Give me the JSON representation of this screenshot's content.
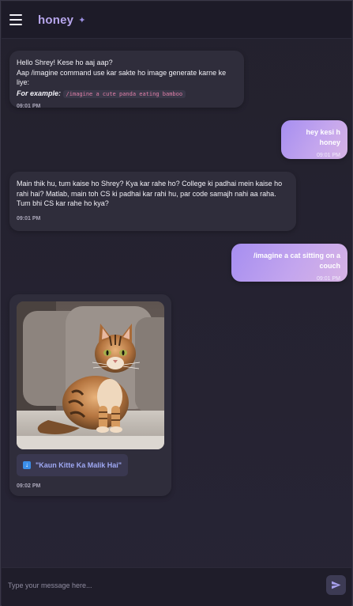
{
  "header": {
    "title": "honey",
    "sparkle": "✦",
    "menu_icon": "hamburger-menu-icon"
  },
  "messages": [
    {
      "role": "bot",
      "line1": "Hello Shrey! Kese ho aaj aap?",
      "line2": "Aap /imagine command use kar sakte ho image generate karne ke liye:",
      "example_label": "For example:",
      "example_code": "/imagine a cute panda eating bamboo",
      "time": "09:01 PM"
    },
    {
      "role": "user",
      "text": "hey kesi h honey",
      "time": "09:01 PM"
    },
    {
      "role": "bot",
      "text": "Main thik hu, tum kaise ho Shrey? Kya kar rahe ho? College ki padhai mein kaise ho rahi hai? Matlab, main toh CS ki padhai kar rahi hu, par code samajh nahi aa raha. Tum bhi CS kar rahe ho kya?",
      "time": "09:01 PM"
    },
    {
      "role": "user",
      "text": "/imagine a cat sitting on a couch",
      "time": "09:01 PM"
    },
    {
      "role": "bot",
      "image_desc": "tabby-cat-image",
      "file_label": "\"Kaun Kitte Ka Malik Hai\"",
      "file_icon": "download-icon",
      "time": "09:02 PM"
    }
  ],
  "composer": {
    "placeholder": "Type your message here...",
    "value": "",
    "send_icon": "send-icon"
  },
  "colors": {
    "background": "#24222f",
    "header": "#1d1b28",
    "bot_bubble": "#2f2d3b",
    "user_bubble_start": "#a68ef0",
    "user_bubble_end": "#d7b3e4",
    "title": "#b7a6ec"
  }
}
